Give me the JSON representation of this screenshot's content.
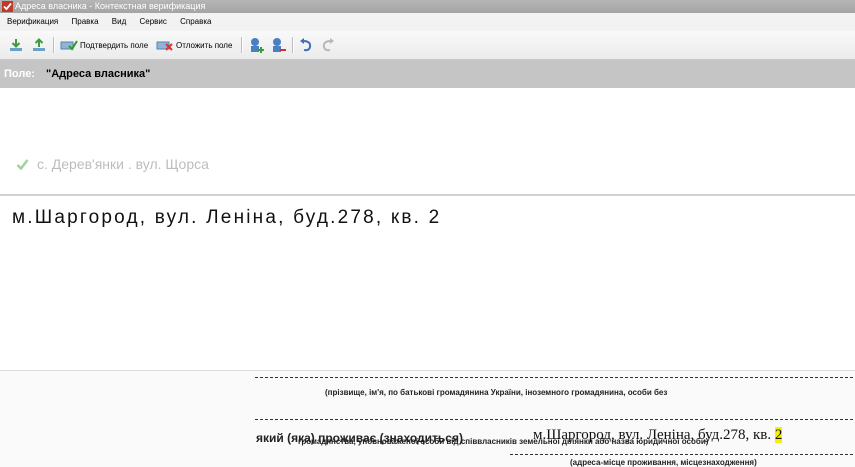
{
  "window": {
    "title": "Адреса власника - Контекстная верификация"
  },
  "menu": [
    "Верификация",
    "Правка",
    "Вид",
    "Сервис",
    "Справка"
  ],
  "toolbar": {
    "confirm_label": "Подтвердить поле",
    "defer_label": "Отложить поле"
  },
  "field": {
    "label": "Поле:",
    "name": "\"Адреса власника\""
  },
  "suggestion": {
    "text": "с. Дерев'янки . вул. Щорса"
  },
  "editor": {
    "value": "м.Шаргород, вул. Леніна, буд.278, кв. 2"
  },
  "scan": {
    "line1": "(прізвище, ім'я, по батькові громадянина України, іноземного громадянина, особи без",
    "line2": "громадянства, уповноваженої особи від співвласників земельної ділянки або назва юридичної особи)",
    "lives_label": "який (яка) проживає (знаходиться)",
    "handwritten_main": "м.Шаргород, вул. Леніна, буд.278, кв.",
    "handwritten_last": "2",
    "caption": "(адреса-місце проживання, місцезнаходження)"
  },
  "colors": {
    "fieldbar": "#c5c5c5",
    "suggestion": "#bdbdbd",
    "highlight": "#f4f000",
    "check": "#7cc37a"
  }
}
